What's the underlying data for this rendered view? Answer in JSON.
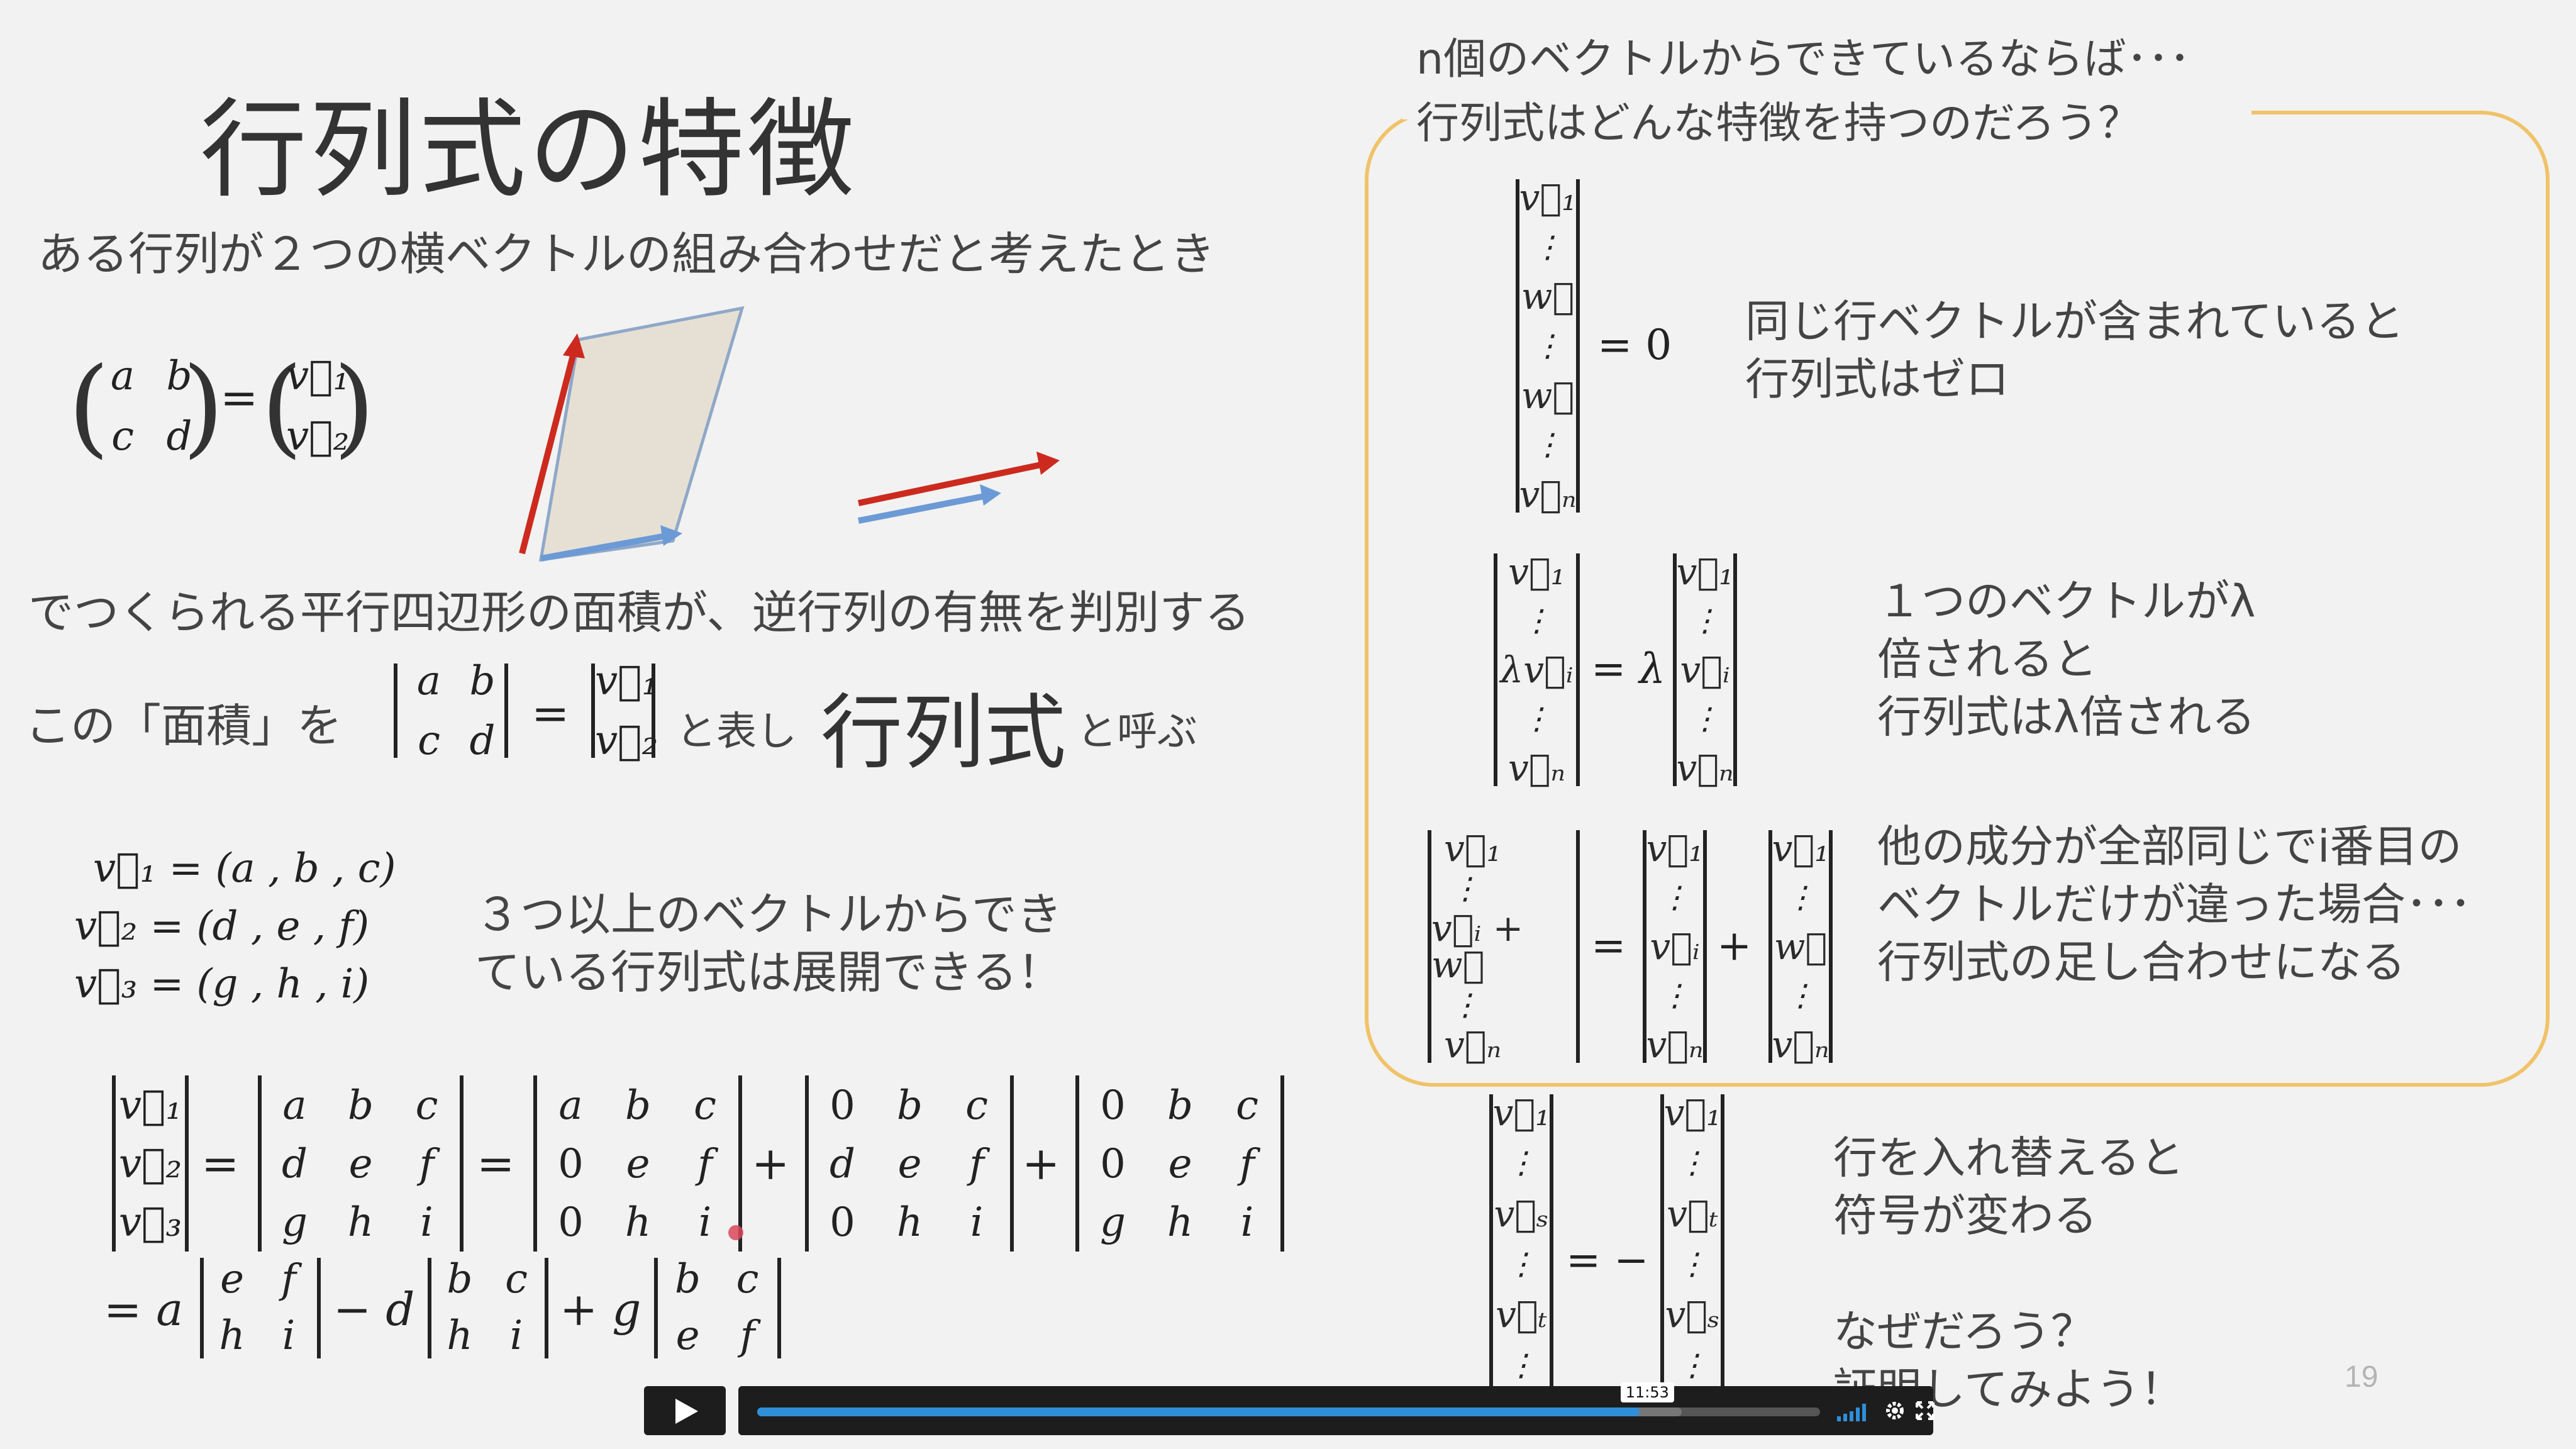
{
  "slide": {
    "title": "行列式の特徴",
    "intro": "ある行列が２つの横ベクトルの組み合わせだと考えたとき",
    "matrix_eq": {
      "a": "a",
      "b": "b",
      "c": "c",
      "d": "d",
      "v1": "v⃗₁",
      "v2": "v⃗₂",
      "eq": "="
    },
    "parallelogram_caption": "でつくられる平行四辺形の面積が、逆行列の有無を判別する",
    "def_line": {
      "prefix": "この「面積」を",
      "suffix_small": "と表し",
      "term": "行列式",
      "suffix_end": "と呼ぶ"
    },
    "vectors": [
      "v⃗₁ = (a , b , c)",
      "v⃗₂ = (d , e , f)",
      "v⃗₃ = (g , h , i)"
    ],
    "expand_note": [
      "３つ以上のベクトルからでき",
      "ている行列式は展開できる！"
    ],
    "expansion_line2": {
      "t1": "= a",
      "t2": "− d",
      "t3": "+ g"
    },
    "plus": "+",
    "zero_col": [
      "0",
      "0",
      "0"
    ],
    "right_heading": [
      "n個のベクトルからできているならば･･･",
      "行列式はどんな特徴を持つのだろう？"
    ],
    "props": [
      {
        "id": "same-rows",
        "text": [
          "同じ行ベクトルが含まれていると",
          "行列式はゼロ"
        ],
        "eq": "= 0"
      },
      {
        "id": "scalar",
        "text": [
          "１つのベクトルがλ",
          "倍されると",
          "行列式はλ倍される"
        ],
        "eq": "= λ"
      },
      {
        "id": "additive",
        "text": [
          "他の成分が全部同じでi番目の",
          "ベクトルだけが違った場合･･･",
          "行列式の足し合わせになる"
        ],
        "eq": "="
      },
      {
        "id": "swap",
        "text": [
          "行を入れ替えると",
          "符号が変わる",
          "",
          "なぜだろう？",
          "証明してみよう！"
        ],
        "eq": "= −"
      }
    ],
    "page_number": "19"
  },
  "player": {
    "time_tooltip": "11:53",
    "progress_fraction": 0.83,
    "buffered_fraction": 0.87
  },
  "colors": {
    "accent_box": "#f0c36a",
    "red_vector": "#cc2a1e",
    "blue_vector": "#6b9ad6",
    "parallelogram": "#e6e0d4",
    "progress": "#2f8fd8"
  }
}
